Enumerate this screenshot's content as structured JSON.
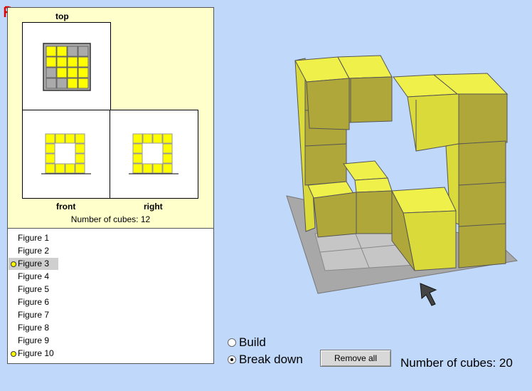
{
  "views": {
    "top_label": "top",
    "front_label": "front",
    "right_label": "right",
    "count_text": "Number of cubes: 12"
  },
  "figures": [
    "Figure 1",
    "Figure 2",
    "Figure 3",
    "Figure 4",
    "Figure 5",
    "Figure 6",
    "Figure 7",
    "Figure 8",
    "Figure 9",
    "Figure 10"
  ],
  "selected_figure": "Figure 3",
  "controls": {
    "build_label": "Build",
    "breakdown_label": "Break down",
    "selected_mode": "Break down",
    "remove_all_label": "Remove all",
    "cube_count_text": "Number of cubes: 20"
  },
  "colors": {
    "cube_top": "#f0f04a",
    "cube_front": "#b0a73a",
    "cube_side": "#dada3a",
    "background": "#c0d9fb",
    "panel": "#ffffcc"
  }
}
